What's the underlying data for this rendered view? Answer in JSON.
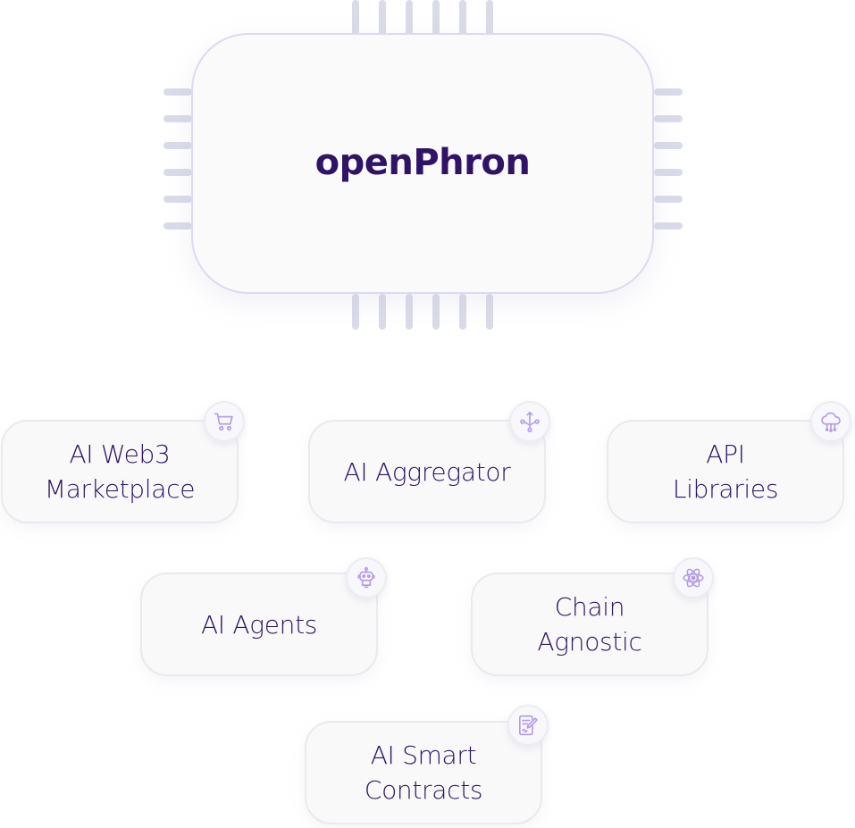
{
  "chip": {
    "title": "openPhron"
  },
  "colors": {
    "title_text": "#2f1366",
    "icon_stroke": "#b49ae6",
    "pin": "#d9dbe8",
    "chip_border": "#dcdaf0",
    "card_border": "#e9e9ef",
    "card_fill": "#f9f9fa"
  },
  "features": [
    {
      "label": "AI Web3\nMarketplace",
      "icon": "shopping-cart-icon"
    },
    {
      "label": "AI Aggregator",
      "icon": "merge-branches-icon"
    },
    {
      "label": "API\nLibraries",
      "icon": "cloud-network-icon"
    },
    {
      "label": "AI Agents",
      "icon": "robot-icon"
    },
    {
      "label": "Chain\nAgnostic",
      "icon": "atom-icon"
    },
    {
      "label": "AI Smart\nContracts",
      "icon": "contract-pen-icon"
    }
  ]
}
